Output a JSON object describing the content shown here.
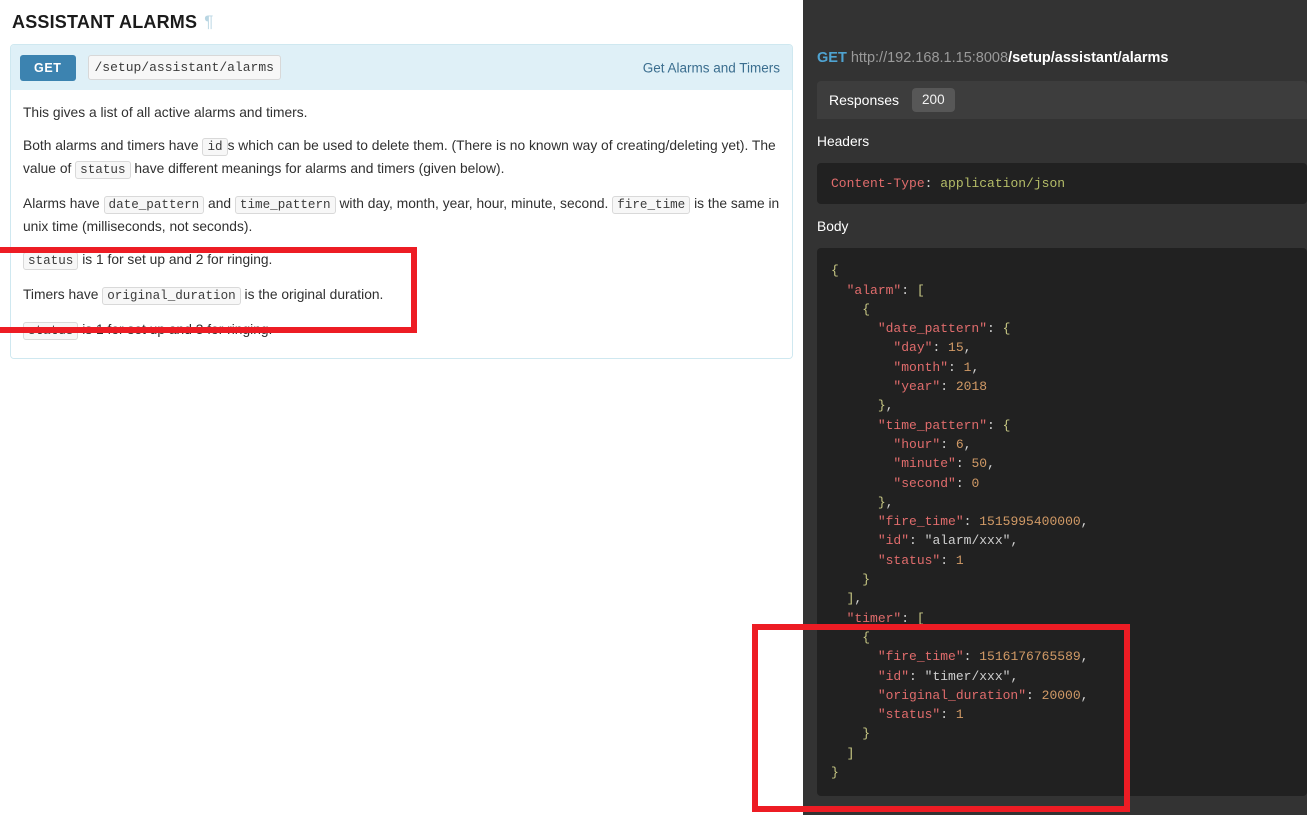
{
  "docs": {
    "title": "ASSISTANT ALARMS",
    "anchor_glyph": "¶",
    "operation": {
      "method": "GET",
      "path": "/setup/assistant/alarms",
      "summary": "Get Alarms and Timers",
      "paragraphs": [
        {
          "id": "p1",
          "parts": [
            {
              "type": "text",
              "text": "This gives a list of all active alarms and timers."
            }
          ]
        },
        {
          "id": "p2",
          "parts": [
            {
              "type": "text",
              "text": "Both alarms and timers have "
            },
            {
              "type": "code",
              "text": "id"
            },
            {
              "type": "text",
              "text": "s which can be used to delete them. (There is no known way of creating/deleting yet). The value of "
            },
            {
              "type": "code",
              "text": "status"
            },
            {
              "type": "text",
              "text": " have different meanings for alarms and timers (given below)."
            }
          ]
        },
        {
          "id": "p3",
          "parts": [
            {
              "type": "text",
              "text": "Alarms have "
            },
            {
              "type": "code",
              "text": "date_pattern"
            },
            {
              "type": "text",
              "text": " and "
            },
            {
              "type": "code",
              "text": "time_pattern"
            },
            {
              "type": "text",
              "text": " with day, month, year, hour, minute, second. "
            },
            {
              "type": "code",
              "text": "fire_time"
            },
            {
              "type": "text",
              "text": " is the same in unix time (milliseconds, not seconds)."
            }
          ]
        },
        {
          "id": "p4",
          "parts": [
            {
              "type": "code",
              "text": "status"
            },
            {
              "type": "text",
              "text": " is 1 for set up and 2 for ringing."
            }
          ]
        },
        {
          "id": "p5",
          "parts": [
            {
              "type": "text",
              "text": "Timers have "
            },
            {
              "type": "code",
              "text": "original_duration"
            },
            {
              "type": "text",
              "text": " is the original duration."
            }
          ]
        },
        {
          "id": "p6",
          "parts": [
            {
              "type": "code",
              "text": "status"
            },
            {
              "type": "text",
              "text": " is 1 for set up and 3 for ringing."
            }
          ]
        }
      ]
    }
  },
  "response": {
    "method": "GET",
    "host": "http://192.168.1.15:8008",
    "path": "/setup/assistant/alarms",
    "tabs_label": "Responses",
    "status_code": "200",
    "headers_label": "Headers",
    "headers_code": [
      {
        "name": "Content-Type",
        "sep": ": ",
        "value": "application/json"
      }
    ],
    "body_label": "Body",
    "body_json": {
      "alarm": [
        {
          "date_pattern": {
            "day": 15,
            "month": 1,
            "year": 2018
          },
          "time_pattern": {
            "hour": 6,
            "minute": 50,
            "second": 0
          },
          "fire_time": 1515995400000,
          "id": "alarm/xxx",
          "status": 1
        }
      ],
      "timer": [
        {
          "fire_time": 1516176765589,
          "id": "timer/xxx",
          "original_duration": 20000,
          "status": 1
        }
      ]
    }
  },
  "annotations": {
    "highlight_color": "#ed1c24",
    "boxes": [
      {
        "name": "timer-docs-highlight"
      },
      {
        "name": "timer-json-highlight"
      }
    ]
  },
  "theme": {
    "method_badge_color": "#3c83b0",
    "op_header_bg": "#dff0f7",
    "panel_bg": "#333333",
    "code_bg": "#212121",
    "link_color": "#3b6e8f"
  }
}
